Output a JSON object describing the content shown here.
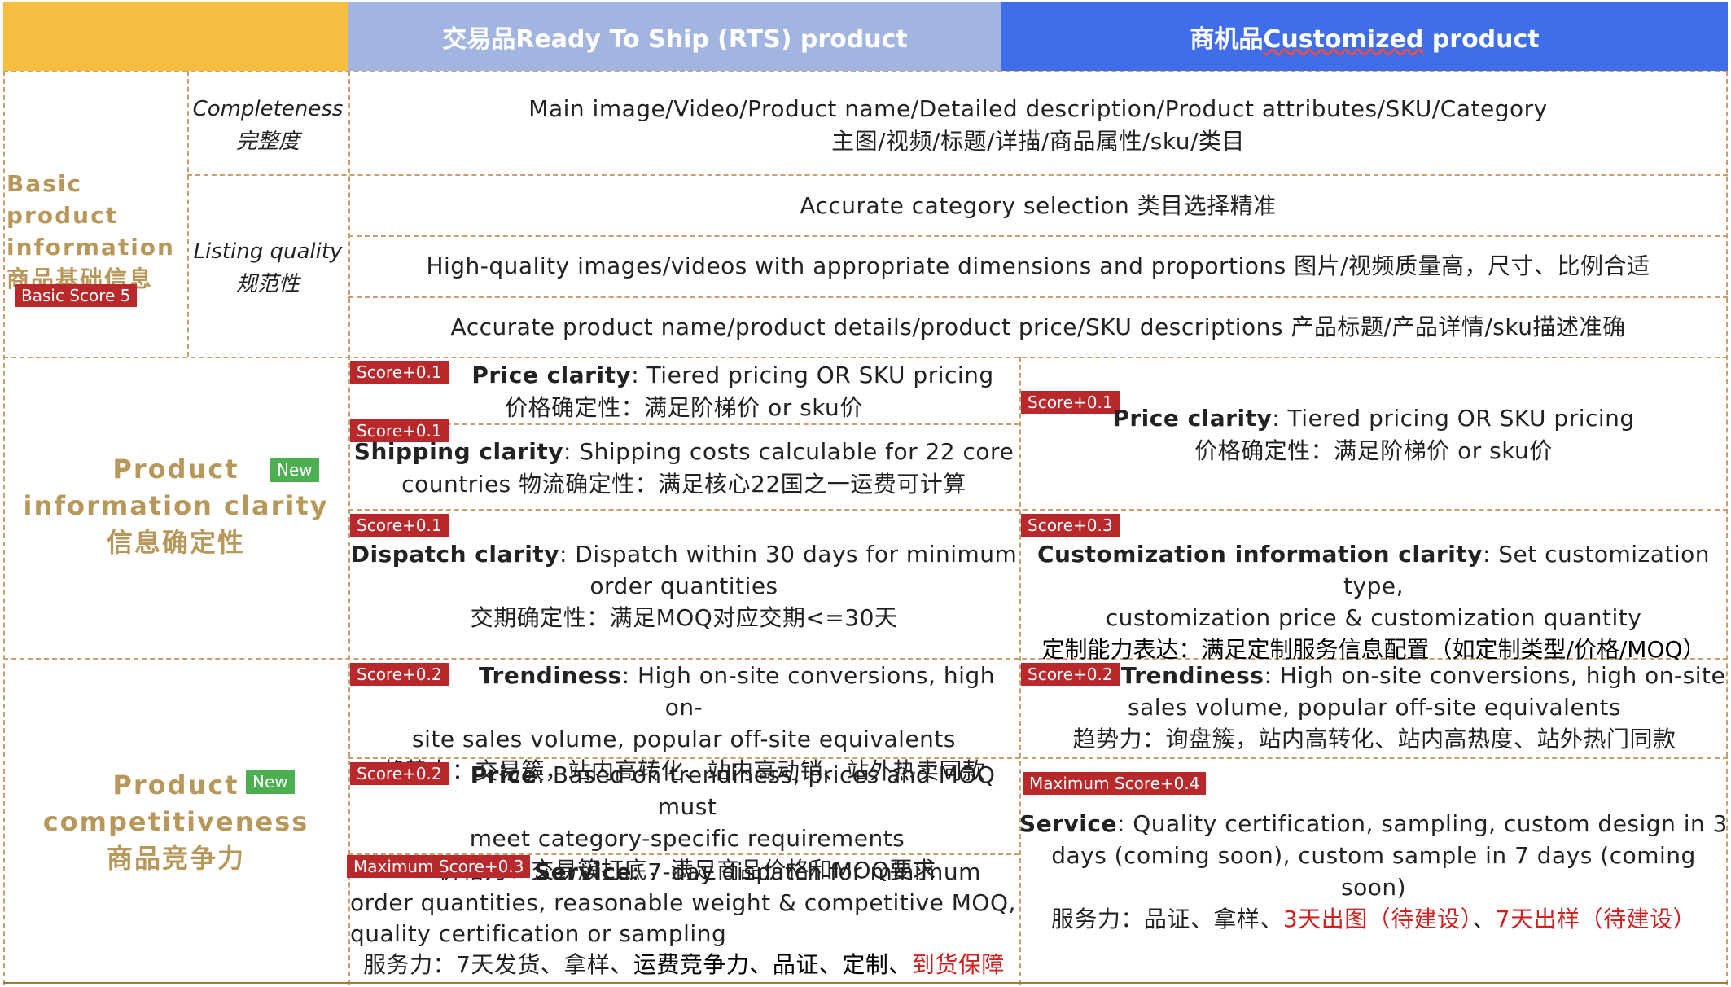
{
  "header": {
    "rts": "交易品Ready To Ship (RTS) product",
    "customized_prefix": "商机品",
    "customized_word": "Customized",
    "customized_suffix": " product"
  },
  "basic": {
    "title_line1": "Basic product",
    "title_line2": "information",
    "title_cn": "商品基础信息",
    "badge": "Basic Score 5",
    "completeness_en": "Completeness",
    "completeness_cn": "完整度",
    "completeness_line1": "Main image/Video/Product name/Detailed description/Product attributes/SKU/Category",
    "completeness_line2": "主图/视频/标题/详描/商品属性/sku/类目",
    "listing_en": "Listing quality",
    "listing_cn": "规范性",
    "listing_row1": "Accurate category selection 类目选择精准",
    "listing_row2": "High-quality images/videos with appropriate dimensions and proportions 图片/视频质量高，尺寸、比例合适",
    "listing_row3": "Accurate product name/product details/product price/SKU descriptions 产品标题/产品详情/sku描述准确"
  },
  "clarity": {
    "title_line1": "Product",
    "title_line2": "information clarity",
    "title_cn": "信息确定性",
    "new_badge": "New",
    "rts_price": {
      "score": "Score+0.1",
      "bold": "Price clarity",
      "text": ": Tiered pricing OR SKU pricing",
      "cn": "价格确定性：满足阶梯价 or sku价"
    },
    "rts_shipping": {
      "score": "Score+0.1",
      "bold": "Shipping clarity",
      "text": ": Shipping costs calculable for 22 core",
      "line2": "countries 物流确定性：满足核心22国之一运费可计算"
    },
    "rts_dispatch": {
      "score": "Score+0.1",
      "bold": "Dispatch clarity",
      "text": ": Dispatch within 30 days for minimum",
      "line2": "order quantities",
      "cn": "交期确定性：满足MOQ对应交期<=30天"
    },
    "cus_price": {
      "score": "Score+0.1",
      "bold": "Price clarity",
      "text": ": Tiered pricing OR SKU pricing",
      "cn": "价格确定性：满足阶梯价 or sku价"
    },
    "cus_custom": {
      "score": "Score+0.3",
      "bold": "Customization information clarity",
      "text": ": Set customization type,",
      "line2": "customization price & customization quantity",
      "cn": "定制能力表达：满足定制服务信息配置（如定制类型/价格/MOQ）"
    }
  },
  "competitiveness": {
    "title_line1": "Product",
    "title_line2": "competitiveness",
    "title_cn": "商品竞争力",
    "new_badge": "New",
    "rts_trend": {
      "score": "Score+0.2",
      "bold": "Trendiness",
      "text": ": High on-site conversions, high on-",
      "line2": "site sales volume, popular off-site equivalents",
      "cn": "趋势力：交易簇，站内高转化、站内高动销、站外热卖同款"
    },
    "rts_price": {
      "score": "Score+0.2",
      "bold": "Price",
      "text": ": Based on trendiness, prices and MOQ must",
      "line2": "meet category-specific requirements",
      "cn": "价格力：交易簇打底，满足商品价格和MOQ要求"
    },
    "rts_service": {
      "score": "Maximum Score+0.3",
      "bold": "Service",
      "text": ": 7-day dispatch for minimum",
      "line2": "order quantities, reasonable weight & competitive MOQ,",
      "line3": "quality certification or sampling",
      "cn_a": "服务力：7天发货、拿样、",
      "cn_b": "运费竞争力、品证、定制、",
      "cn_red": "到货保障"
    },
    "cus_trend": {
      "score": "Score+0.2",
      "bold": "Trendiness",
      "text": ": High on-site conversions, high on-site",
      "line2": "sales volume, popular off-site equivalents",
      "cn": "趋势力：询盘簇，站内高转化、站内高热度、站外热门同款"
    },
    "cus_service": {
      "score": "Maximum Score+0.4",
      "bold": "Service",
      "text": ": Quality certification, sampling, custom design in 3",
      "line2": "days (coming soon), custom sample in 7 days (coming soon)",
      "cn_a": "服务力：品证、拿样、",
      "cn_red1": "3天出图（待建设）",
      "cn_sep": "、",
      "cn_red2": "7天出样（待建设）"
    }
  }
}
